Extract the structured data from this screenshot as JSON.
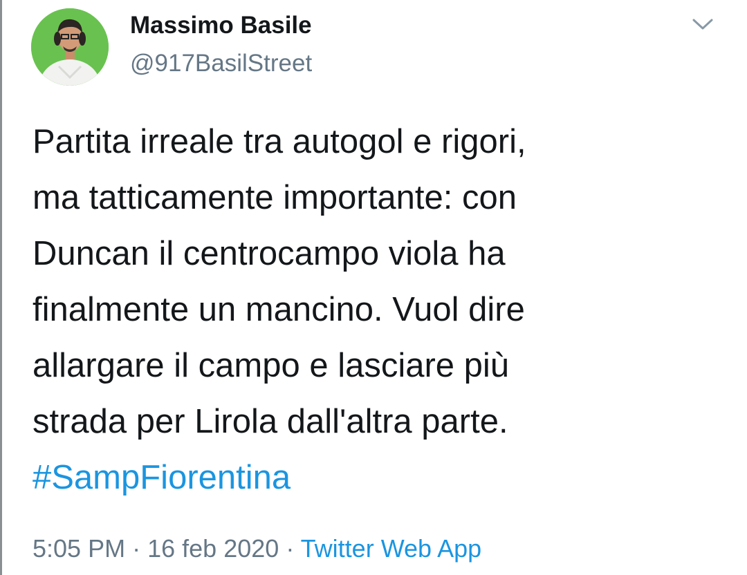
{
  "user": {
    "name": "Massimo Basile",
    "handle": "@917BasilStreet",
    "avatar_icon": "profile-photo"
  },
  "tweet": {
    "lines": [
      "Partita irreale tra autogol e rigori,",
      "ma tatticamente importante: con",
      "Duncan il centrocampo viola ha",
      "finalmente un mancino. Vuol dire",
      "allargare il campo e lasciare più",
      "strada per Lirola dall'altra parte."
    ],
    "hashtag": "#SampFiorentina"
  },
  "meta": {
    "time": "5:05 PM",
    "separator": "·",
    "date": "16 feb 2020",
    "source": "Twitter Web App"
  },
  "menu_icon": "chevron-down-icon",
  "colors": {
    "text": "#14171a",
    "secondary": "#657786",
    "link": "#1b95e0",
    "avatar_bg": "#69c24f"
  }
}
